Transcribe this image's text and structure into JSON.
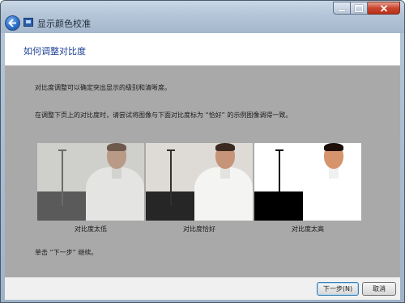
{
  "window": {
    "title": "显示颜色校准"
  },
  "header": {
    "page_title": "如何调整对比度"
  },
  "content": {
    "description_1": "对比度调整可以确定突出显示的级别和清晰度。",
    "description_2": "在调整下页上的对比度时，请尝试将图像与下面对比度标为 “恰好” 的示例图像调得一致。",
    "samples": [
      {
        "caption": "对比度太低"
      },
      {
        "caption": "对比度恰好"
      },
      {
        "caption": "对比度太高"
      }
    ],
    "continue_hint": "单击 “下一步” 继续。"
  },
  "footer": {
    "next_label": "下一步(N)",
    "cancel_label": "取消"
  },
  "icons": {
    "back": "back-arrow-icon",
    "app": "display-icon",
    "minimize": "minimize-icon",
    "maximize": "maximize-icon",
    "close": "close-icon"
  },
  "colors": {
    "title_blue": "#1c3f94",
    "content_gray": "#a9a9a9",
    "close_red": "#c9452e"
  }
}
